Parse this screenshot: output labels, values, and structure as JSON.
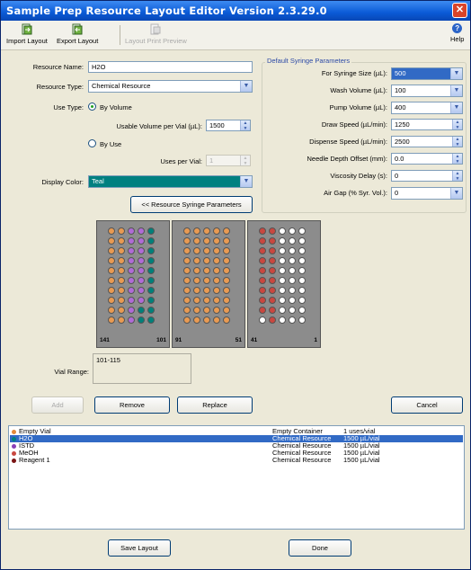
{
  "window": {
    "title": "Sample Prep Resource Layout Editor Version 2.3.29.0",
    "close_glyph": "✕"
  },
  "toolbar": {
    "import_label": "Import Layout",
    "export_label": "Export Layout",
    "preview_label": "Layout Print Preview",
    "help_label": "Help",
    "help_glyph": "?"
  },
  "form": {
    "resource_name_label": "Resource Name:",
    "resource_name_value": "H2O",
    "resource_type_label": "Resource Type:",
    "resource_type_value": "Chemical Resource",
    "use_type_label": "Use Type:",
    "by_volume_label": "By Volume",
    "usable_volume_label": "Usable Volume per Vial (µL):",
    "usable_volume_value": "1500",
    "by_use_label": "By Use",
    "uses_per_vial_label": "Uses per Vial:",
    "uses_per_vial_value": "1",
    "display_color_label": "Display Color:",
    "display_color_value": "Teal",
    "display_color_hex": "#008080",
    "syringe_button": "<< Resource Syringe Parameters",
    "vial_range_label": "Vial Range:",
    "vial_range_value": "101-115"
  },
  "syringe": {
    "group_title": "Default Syringe Parameters",
    "fields": [
      {
        "label": "For Syringe Size (µL):",
        "value": "500",
        "kind": "combo",
        "highlight": true
      },
      {
        "label": "Wash Volume (µL):",
        "value": "100",
        "kind": "combo"
      },
      {
        "label": "Pump Volume (µL):",
        "value": "400",
        "kind": "combo"
      },
      {
        "label": "Draw Speed (µL/min):",
        "value": "1250",
        "kind": "spin"
      },
      {
        "label": "Dispense Speed (µL/min):",
        "value": "2500",
        "kind": "spin"
      },
      {
        "label": "Needle Depth Offset (mm):",
        "value": "0.0",
        "kind": "spin"
      },
      {
        "label": "Viscosity Delay (s):",
        "value": "0",
        "kind": "spin"
      },
      {
        "label": "Air Gap (% Syr. Vol.):",
        "value": "0",
        "kind": "combo"
      }
    ]
  },
  "trays": [
    {
      "left_num": "141",
      "right_num": "101"
    },
    {
      "left_num": "91",
      "right_num": "51"
    },
    {
      "left_num": "41",
      "right_num": "1"
    }
  ],
  "colors": {
    "orange": "#e89a52",
    "purple": "#b06bd6",
    "teal": "#00807a",
    "empty": "#ffffff",
    "red": "#c9473f"
  },
  "actions": {
    "add": "Add",
    "remove": "Remove",
    "replace": "Replace",
    "cancel": "Cancel",
    "save": "Save Layout",
    "done": "Done"
  },
  "resources": [
    {
      "name": "Empty Vial",
      "type": "Empty Container",
      "qty": "1 uses/vial",
      "color": "#e58a3a",
      "selected": false
    },
    {
      "name": "H2O",
      "type": "Chemical Resource",
      "qty": "1500 µL/vial",
      "color": "#008080",
      "selected": true
    },
    {
      "name": "ISTD",
      "type": "Chemical Resource",
      "qty": "1500 µL/vial",
      "color": "#8a3fb8",
      "selected": false
    },
    {
      "name": "MeOH",
      "type": "Chemical Resource",
      "qty": "1500 µL/vial",
      "color": "#c9473f",
      "selected": false
    },
    {
      "name": "Reagent 1",
      "type": "Chemical Resource",
      "qty": "1500 µL/vial",
      "color": "#7a1414",
      "selected": false
    }
  ]
}
